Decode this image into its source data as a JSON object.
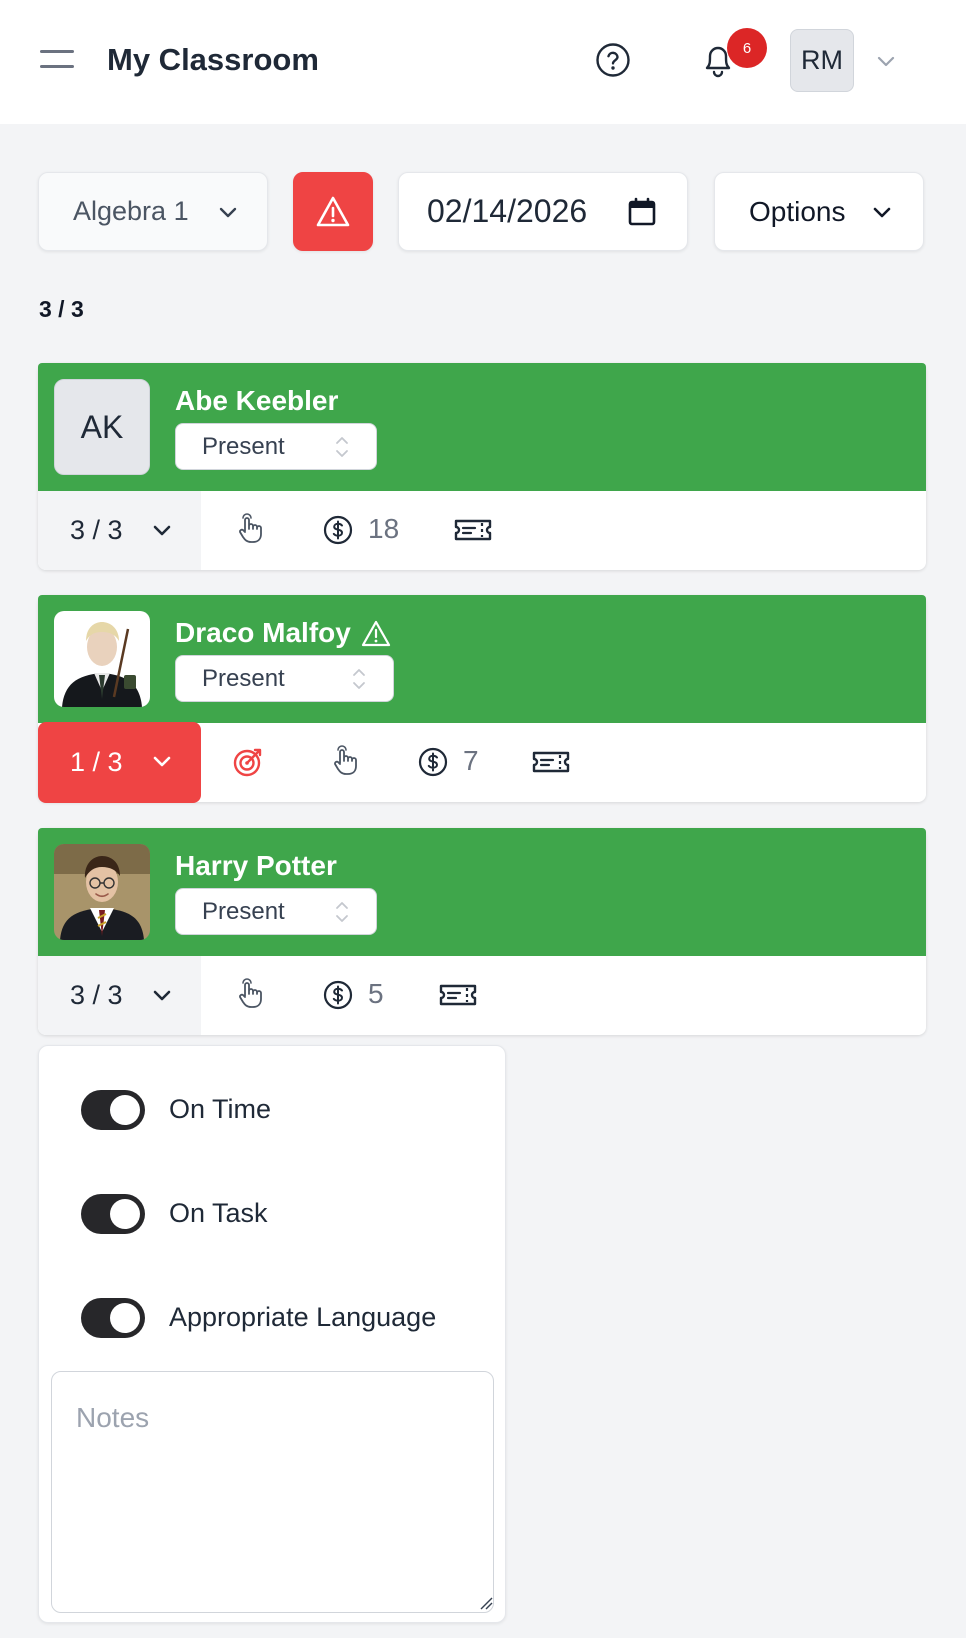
{
  "header": {
    "title": "My Classroom",
    "notification_count": "6",
    "user_initials": "RM"
  },
  "toolbar": {
    "class_select": "Algebra 1",
    "date": "02/14/2026",
    "options_label": "Options",
    "alert_color": "#ef4444"
  },
  "roster_count": "3 / 3",
  "students": [
    {
      "name": "Abe Keebler",
      "initials": "AK",
      "attendance": "Present",
      "score": "3 / 3",
      "coins": "18",
      "flagged": false
    },
    {
      "name": "Draco Malfoy",
      "attendance": "Present",
      "score": "1 / 3",
      "coins": "7",
      "flagged": true
    },
    {
      "name": "Harry Potter",
      "attendance": "Present",
      "score": "3 / 3",
      "coins": "5",
      "flagged": false
    }
  ],
  "behavior": {
    "toggles": [
      {
        "label": "On Time",
        "on": true
      },
      {
        "label": "On Task",
        "on": true
      },
      {
        "label": "Appropriate Language",
        "on": true
      }
    ],
    "notes_placeholder": "Notes"
  },
  "icons": [
    "menu-icon",
    "help-icon",
    "bell-icon",
    "chevron-down-icon",
    "warning-icon",
    "calendar-icon",
    "hand-pointer-icon",
    "dollar-coin-icon",
    "ticket-icon",
    "target-icon",
    "updown-icon"
  ],
  "colors": {
    "present_green": "#3fa64b",
    "badge_red": "#dc2626",
    "toggle_dark": "#27272a"
  }
}
